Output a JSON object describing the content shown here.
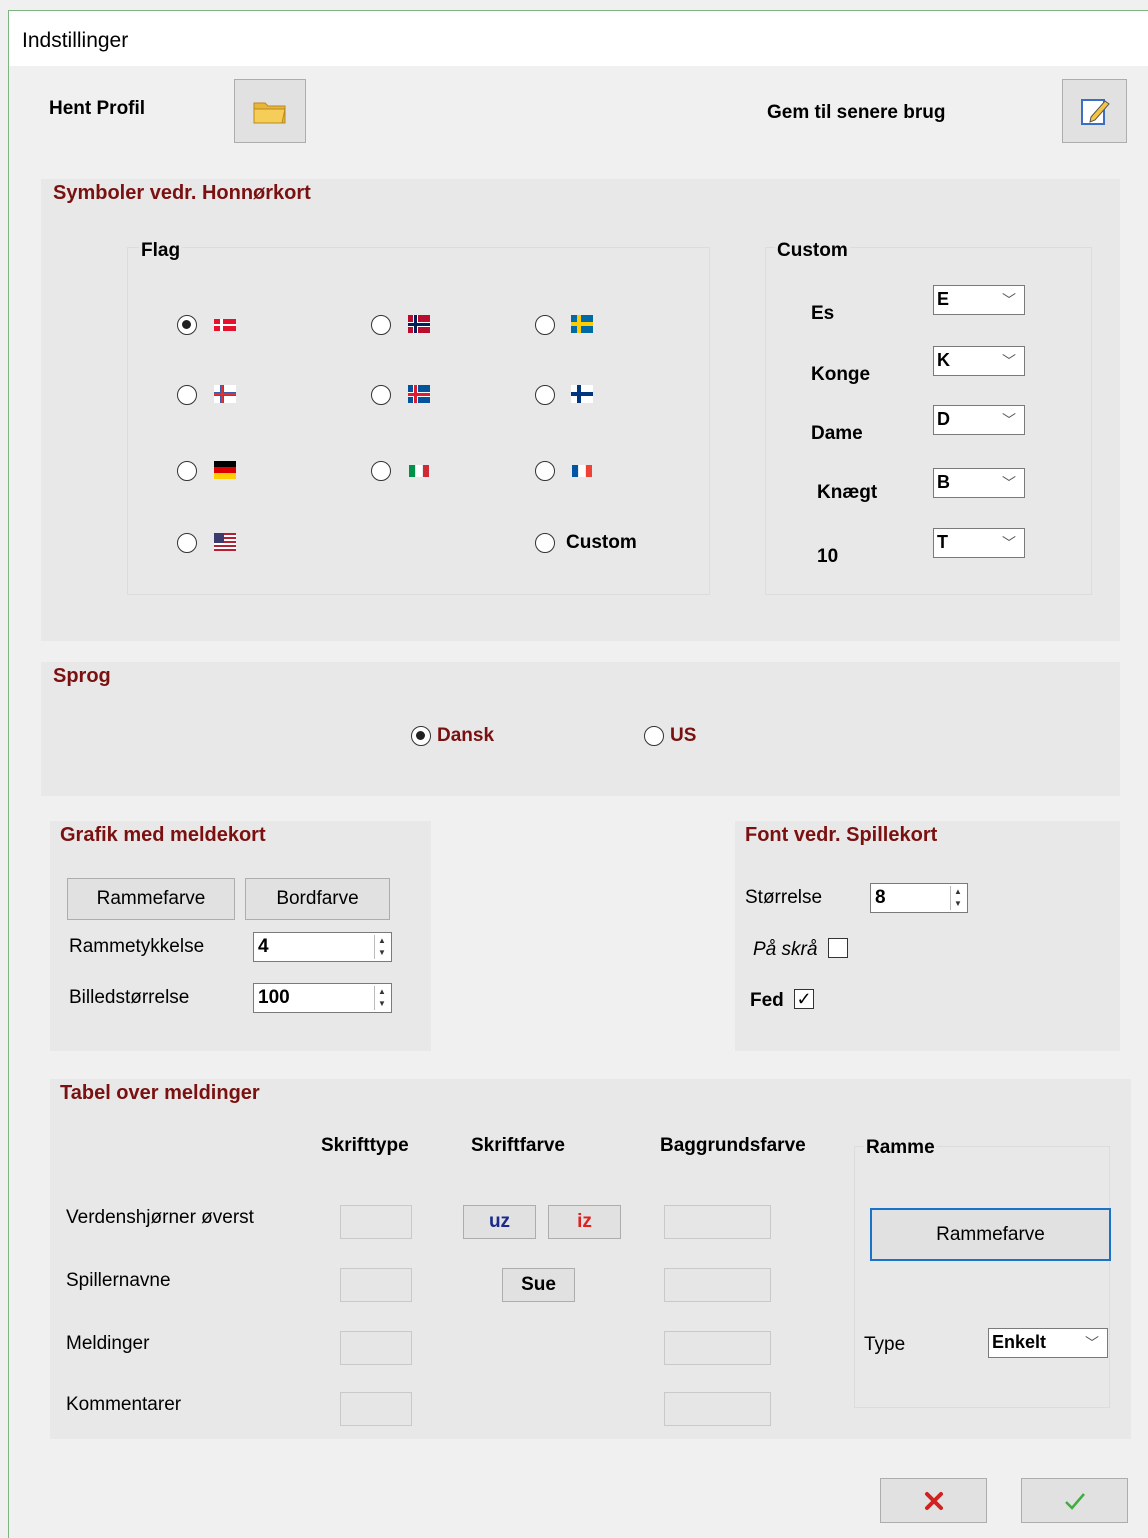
{
  "window": {
    "title": "Indstillinger"
  },
  "top": {
    "load_label": "Hent Profil",
    "save_label": "Gem til senere brug"
  },
  "symbols": {
    "title": "Symboler vedr. Honnørkort",
    "flag_title": "Flag",
    "custom_option_label": "Custom",
    "custom_title": "Custom",
    "rows": [
      {
        "label": "Es",
        "value": "E"
      },
      {
        "label": "Konge",
        "value": "K"
      },
      {
        "label": "Dame",
        "value": "D"
      },
      {
        "label": "Knægt",
        "value": "B"
      },
      {
        "label": "10",
        "value": "T"
      }
    ]
  },
  "language": {
    "title": "Sprog",
    "options": [
      "Dansk",
      "US"
    ]
  },
  "grafik": {
    "title": "Grafik med meldekort",
    "frame_color_label": "Rammefarve",
    "table_color_label": "Bordfarve",
    "thickness_label": "Rammetykkelse",
    "thickness_value": "4",
    "imagesize_label": "Billedstørrelse",
    "imagesize_value": "100"
  },
  "font": {
    "title": "Font vedr. Spillekort",
    "size_label": "Størrelse",
    "size_value": "8",
    "italic_label": "På skrå",
    "bold_label": "Fed"
  },
  "tabel": {
    "title": "Tabel over meldinger",
    "col_font": "Skrifttype",
    "col_color": "Skriftfarve",
    "col_bg": "Baggrundsfarve",
    "rows": [
      "Verdenshjørner øverst",
      "Spillernavne",
      "Meldinger",
      "Kommentarer"
    ],
    "uz": "uz",
    "iz": "iz",
    "sue": "Sue",
    "frame_title": "Ramme",
    "frame_color_label": "Rammefarve",
    "type_label": "Type",
    "type_value": "Enkelt"
  },
  "colors": {
    "group_title": "#7a1010",
    "uz": "#1a2a8c",
    "iz": "#e02020",
    "focus": "#1a73c8"
  }
}
